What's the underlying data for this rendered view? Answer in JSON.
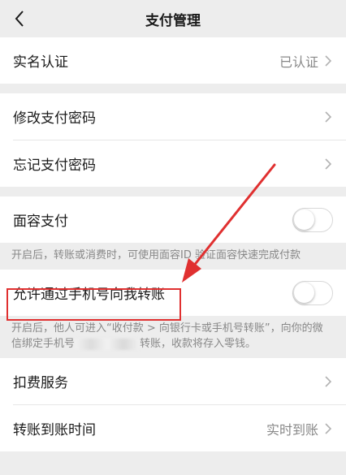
{
  "nav": {
    "title": "支付管理"
  },
  "rows": {
    "realname": {
      "label": "实名认证",
      "value": "已认证"
    },
    "change_pwd": {
      "label": "修改支付密码"
    },
    "forgot_pwd": {
      "label": "忘记支付密码"
    },
    "face_pay": {
      "label": "面容支付",
      "enabled": false
    },
    "phone_transfer": {
      "label": "允许通过手机号向我转账",
      "enabled": false
    },
    "deduction": {
      "label": "扣费服务"
    },
    "arrival_time": {
      "label": "转账到账时间",
      "value": "实时到账"
    }
  },
  "desc": {
    "face_pay": "开启后，转账或消费时，可使用面容ID 验证面容快速完成付款",
    "phone_transfer_a": "开启后，他人可进入“收付款 > 向银行卡或手机号转账”，向你的微信绑定手机号",
    "phone_transfer_b": "转账，收款将存入零钱。"
  },
  "colors": {
    "highlight": "#e03030",
    "background": "#ededed"
  }
}
